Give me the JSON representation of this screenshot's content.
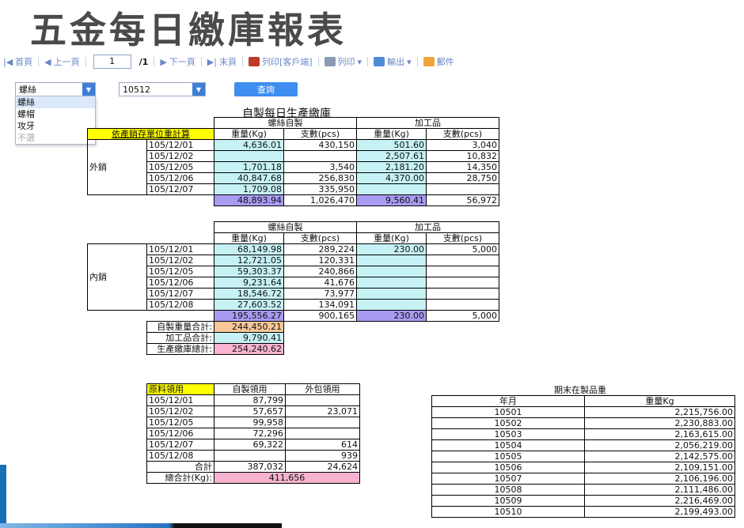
{
  "page_title": "五金每日繳庫報表",
  "toolbar": {
    "first": "首頁",
    "prev": "上一頁",
    "page_value": "1",
    "page_total": "/1",
    "next": "下一頁",
    "last": "末頁",
    "print_client": "列印[客戶端]",
    "print": "列印",
    "export": "輸出",
    "mail": "郵件"
  },
  "filter": {
    "category_value": "螺絲",
    "code_value": "10512",
    "query_label": "查詢",
    "options": [
      "螺絲",
      "螺帽",
      "攻牙",
      "不選"
    ]
  },
  "report": {
    "title": "自製每日生產繳庫",
    "group_self": "螺絲自製",
    "group_outsource": "加工品",
    "col_weight": "重量(Kg)",
    "col_count": "支數(pcs)",
    "calc_label": "依產銷存單位重計算",
    "export_label": "外銷",
    "domestic_label": "內銷",
    "export_rows": [
      [
        "105/12/01",
        "4,636.01",
        "430,150",
        "501.60",
        "3,040"
      ],
      [
        "105/12/02",
        "",
        "",
        "2,507.61",
        "10,832"
      ],
      [
        "105/12/05",
        "1,701.18",
        "3,540",
        "2,181.20",
        "14,350"
      ],
      [
        "105/12/06",
        "40,847.68",
        "256,830",
        "4,370.00",
        "28,750"
      ],
      [
        "105/12/07",
        "1,709.08",
        "335,950",
        "",
        ""
      ]
    ],
    "export_total": [
      "48,893.94",
      "1,026,470",
      "9,560.41",
      "56,972"
    ],
    "domestic_rows": [
      [
        "105/12/01",
        "68,149.98",
        "289,224",
        "230.00",
        "5,000"
      ],
      [
        "105/12/02",
        "12,721.05",
        "120,331",
        "",
        ""
      ],
      [
        "105/12/05",
        "59,303.37",
        "240,866",
        "",
        ""
      ],
      [
        "105/12/06",
        "9,231.64",
        "41,676",
        "",
        ""
      ],
      [
        "105/12/07",
        "18,546.72",
        "73,977",
        "",
        ""
      ],
      [
        "105/12/08",
        "27,603.52",
        "134,091",
        "",
        ""
      ]
    ],
    "domestic_total": [
      "195,556.27",
      "900,165",
      "230.00",
      "5,000"
    ],
    "summary": [
      {
        "label": "自製重量合計:",
        "value": "244,450.21"
      },
      {
        "label": "加工品合計:",
        "value": "9,790.41"
      },
      {
        "label": "生產繳庫總計:",
        "value": "254,240.62"
      }
    ]
  },
  "material": {
    "header_label": "原料領用",
    "col_self": "自製領用",
    "col_outsource": "外包領用",
    "rows": [
      [
        "105/12/01",
        "87,799",
        ""
      ],
      [
        "105/12/02",
        "57,657",
        "23,071"
      ],
      [
        "105/12/05",
        "99,958",
        ""
      ],
      [
        "105/12/06",
        "72,296",
        ""
      ],
      [
        "105/12/07",
        "69,322",
        "614"
      ],
      [
        "105/12/08",
        "",
        "939"
      ]
    ],
    "subtotal_label": "合計",
    "subtotal": [
      "387,032",
      "24,624"
    ],
    "grand_label": "總合計(Kg):",
    "grand_value": "411,656"
  },
  "wip": {
    "title": "期末在製品重",
    "col_month": "年月",
    "col_weight": "重量Kg",
    "rows": [
      [
        "10501",
        "2,215,756.00"
      ],
      [
        "10502",
        "2,230,883.00"
      ],
      [
        "10503",
        "2,163,615.00"
      ],
      [
        "10504",
        "2,056,219.00"
      ],
      [
        "10505",
        "2,142,575.00"
      ],
      [
        "10506",
        "2,109,151.00"
      ],
      [
        "10507",
        "2,106,196.00"
      ],
      [
        "10508",
        "2,111,486.00"
      ],
      [
        "10509",
        "2,216,469.00"
      ],
      [
        "10510",
        "2,199,493.00"
      ]
    ]
  }
}
